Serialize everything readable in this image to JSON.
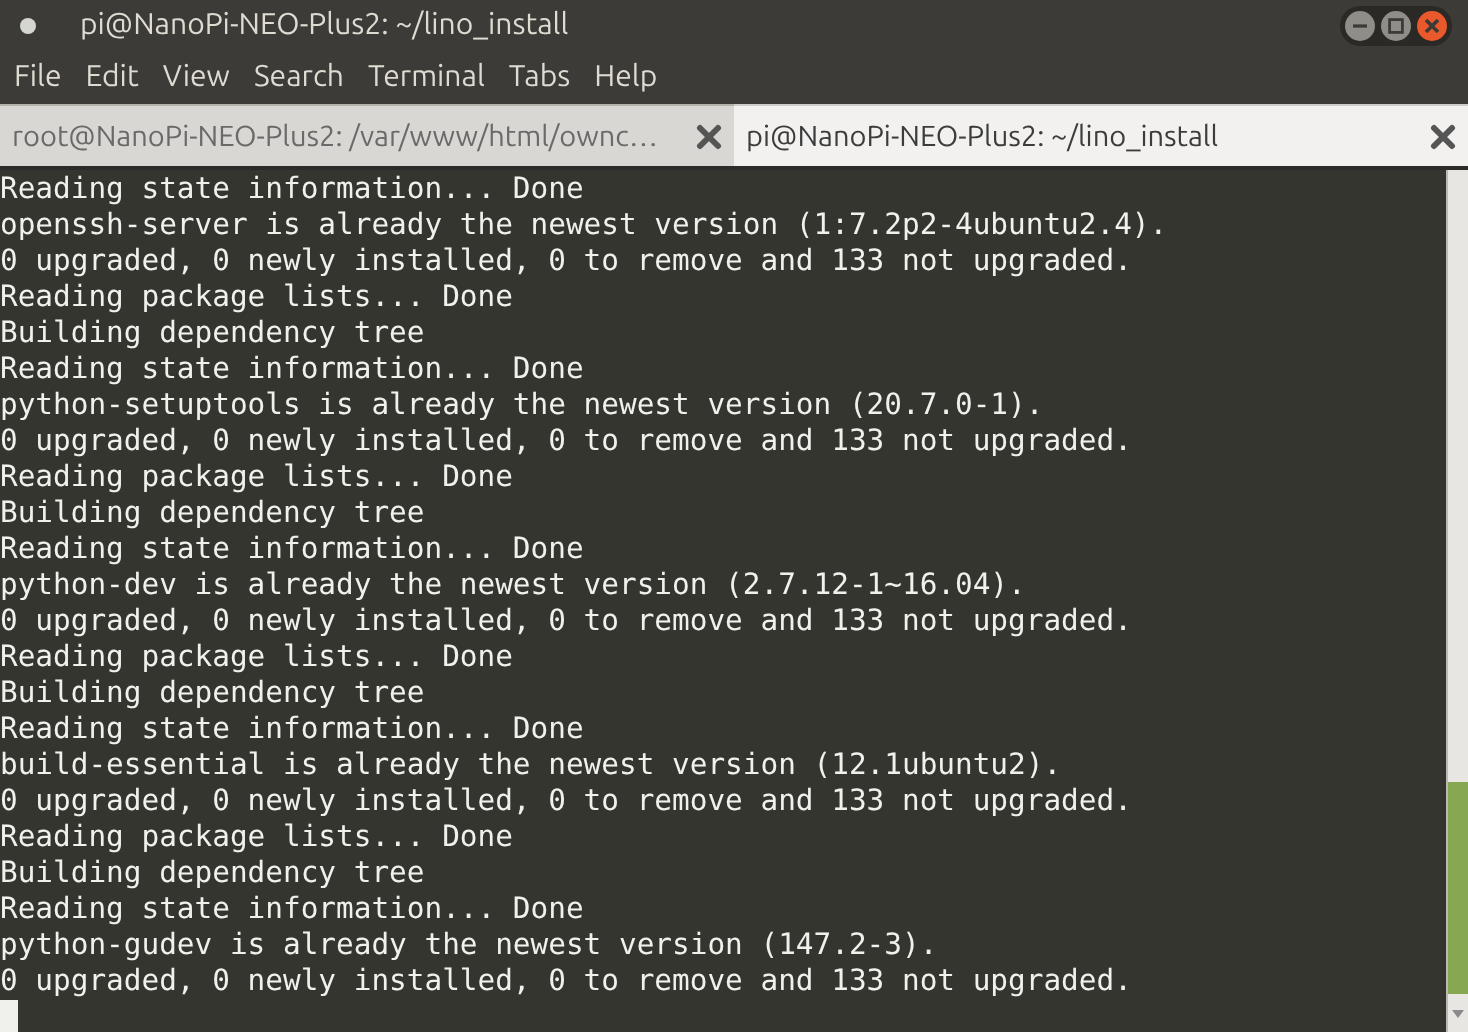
{
  "window": {
    "title": "pi@NanoPi-NEO-Plus2: ~/lino_install"
  },
  "menu": [
    "File",
    "Edit",
    "View",
    "Search",
    "Terminal",
    "Tabs",
    "Help"
  ],
  "tabs": [
    {
      "label": "root@NanoPi-NEO-Plus2: /var/www/html/ownc…",
      "selected": false
    },
    {
      "label": "pi@NanoPi-NEO-Plus2: ~/lino_install",
      "selected": true
    }
  ],
  "terminal": {
    "lines": [
      "Reading state information... Done",
      "openssh-server is already the newest version (1:7.2p2-4ubuntu2.4).",
      "0 upgraded, 0 newly installed, 0 to remove and 133 not upgraded.",
      "Reading package lists... Done",
      "Building dependency tree",
      "Reading state information... Done",
      "python-setuptools is already the newest version (20.7.0-1).",
      "0 upgraded, 0 newly installed, 0 to remove and 133 not upgraded.",
      "Reading package lists... Done",
      "Building dependency tree",
      "Reading state information... Done",
      "python-dev is already the newest version (2.7.12-1~16.04).",
      "0 upgraded, 0 newly installed, 0 to remove and 133 not upgraded.",
      "Reading package lists... Done",
      "Building dependency tree",
      "Reading state information... Done",
      "build-essential is already the newest version (12.1ubuntu2).",
      "0 upgraded, 0 newly installed, 0 to remove and 133 not upgraded.",
      "Reading package lists... Done",
      "Building dependency tree",
      "Reading state information... Done",
      "python-gudev is already the newest version (147.2-3).",
      "0 upgraded, 0 newly installed, 0 to remove and 133 not upgraded."
    ]
  }
}
